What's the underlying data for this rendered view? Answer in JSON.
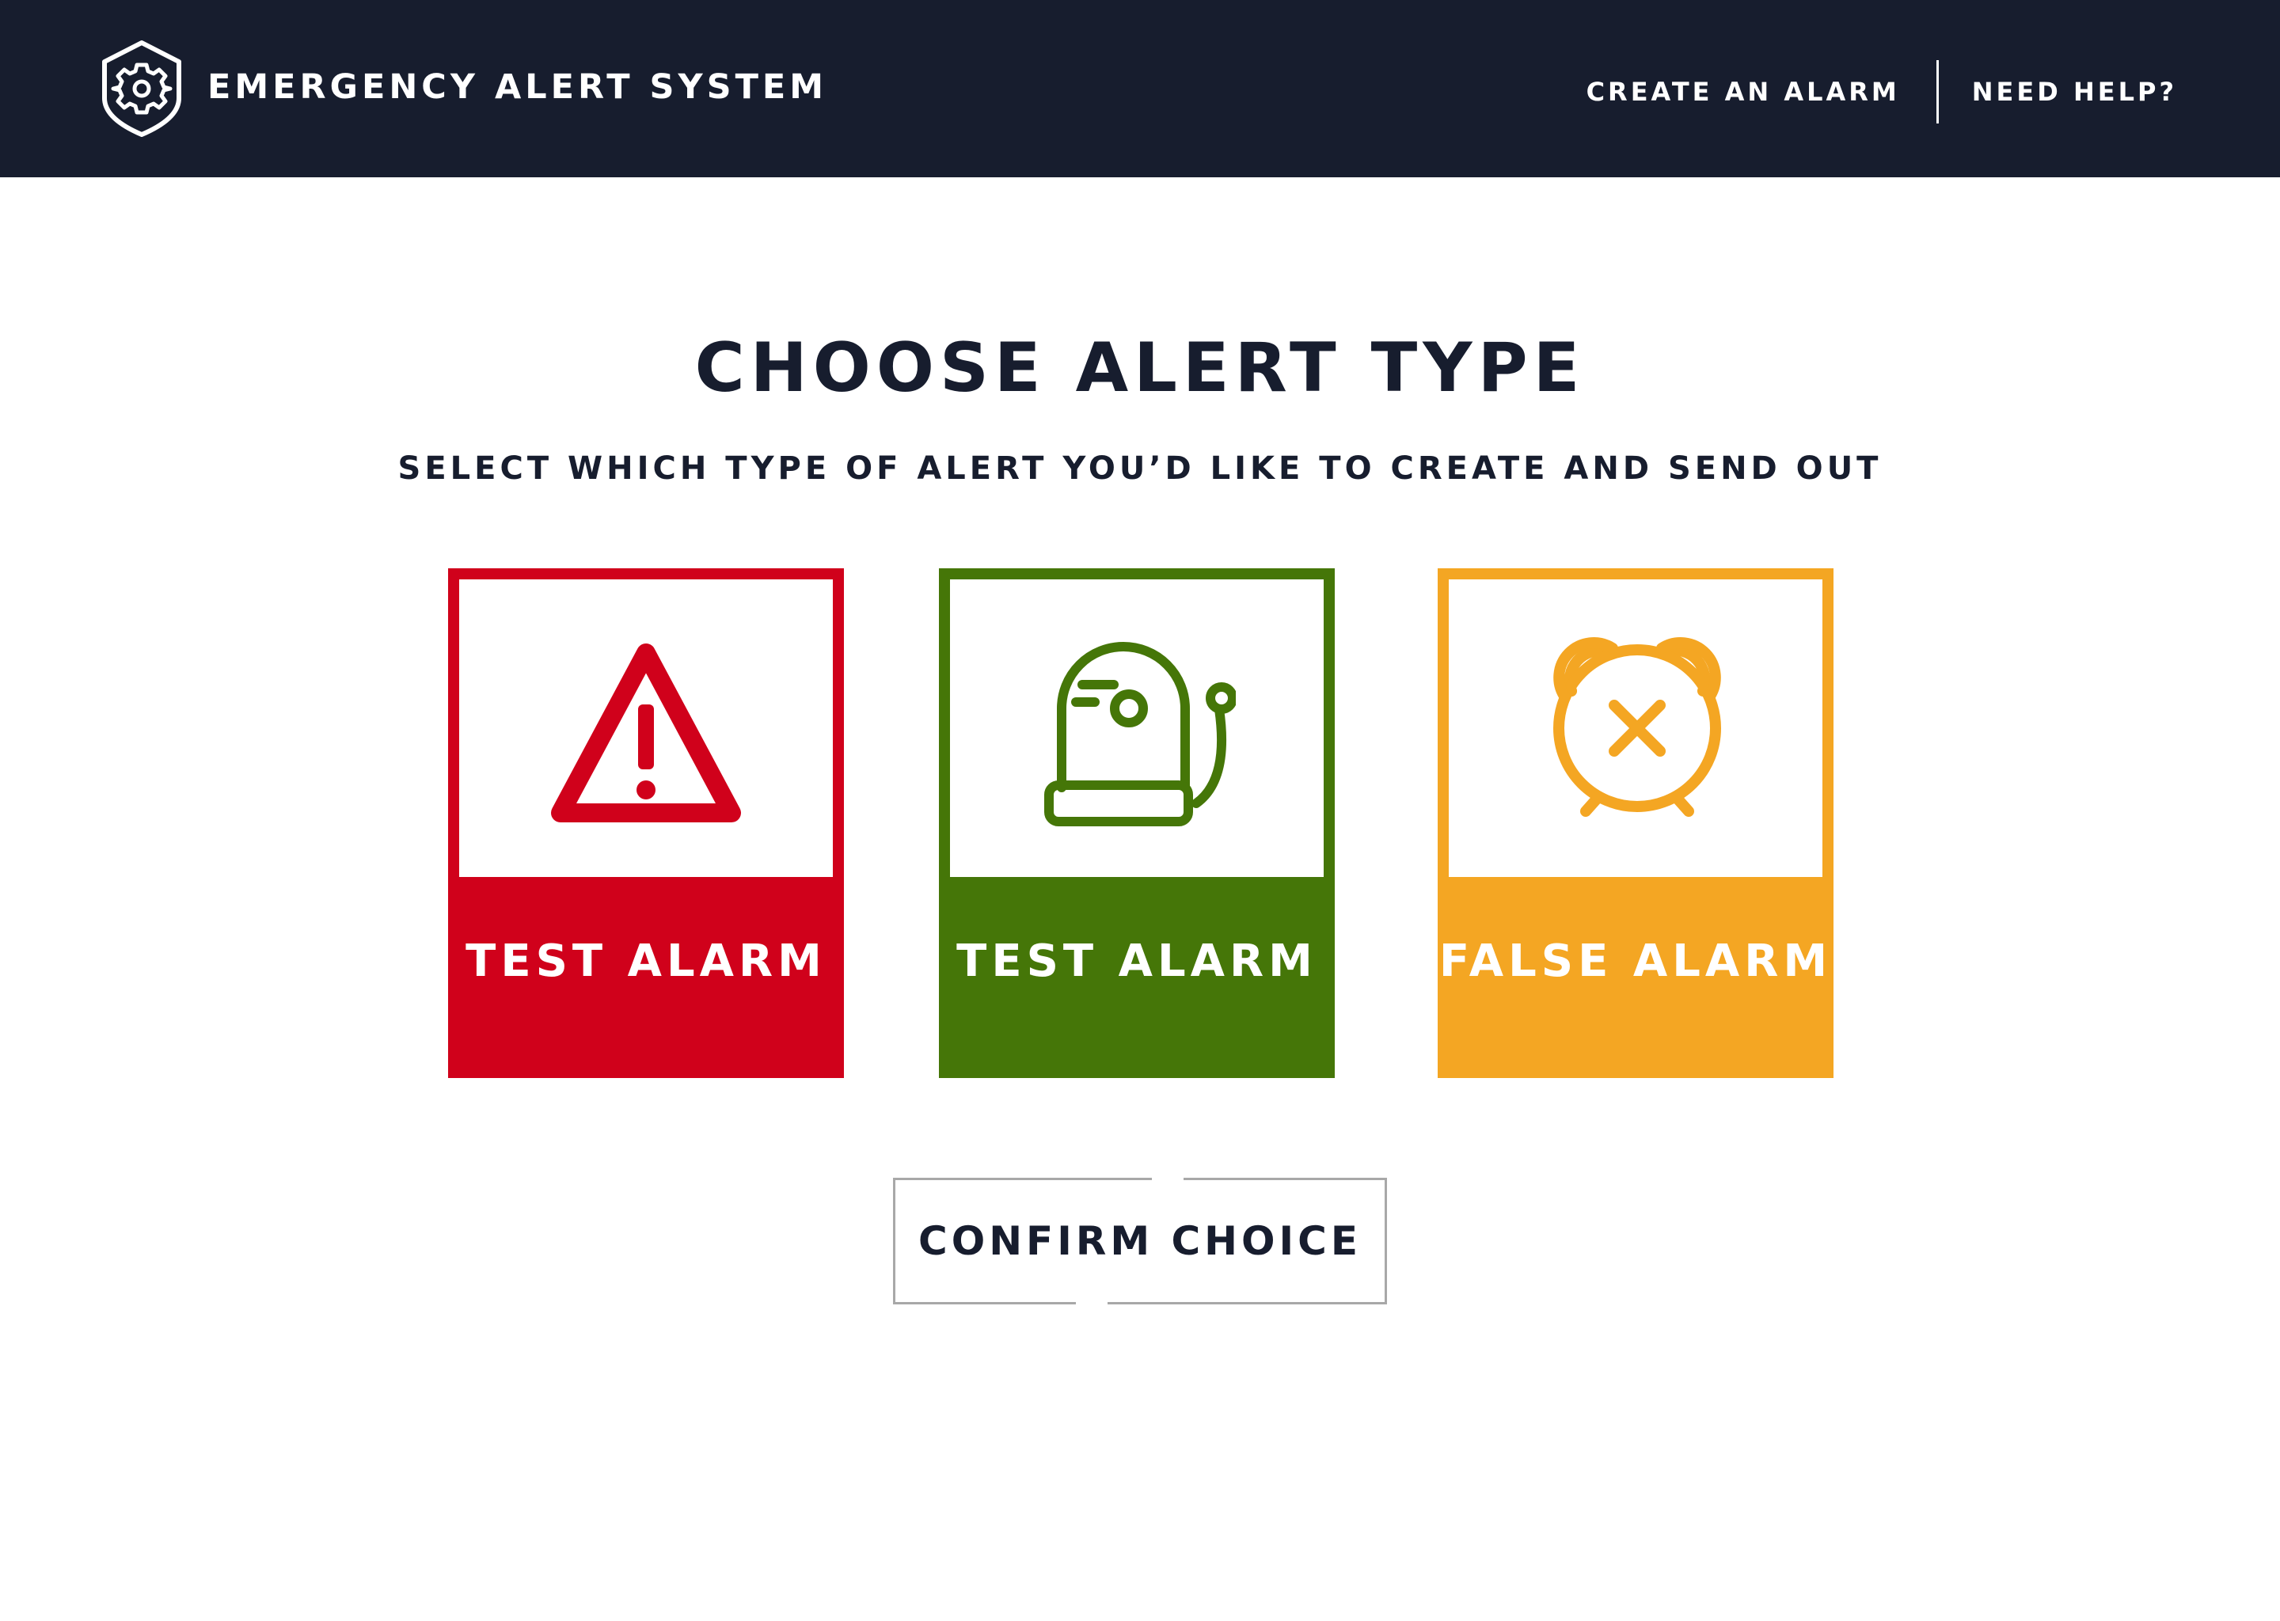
{
  "header": {
    "brand": "EMERGENCY ALERT SYSTEM",
    "logo_icon": "shield-gear-icon",
    "nav": {
      "create": "CREATE AN ALARM",
      "help": "NEED HELP?"
    }
  },
  "main": {
    "title": "CHOOSE ALERT TYPE",
    "subtitle": "SELECT WHICH TYPE OF ALERT YOU’D LIKE TO CREATE AND SEND OUT",
    "cards": [
      {
        "label": "TEST ALARM",
        "icon": "warning-triangle-icon",
        "color": "#d0011b"
      },
      {
        "label": "TEST ALARM",
        "icon": "alarm-bell-icon",
        "color": "#457608"
      },
      {
        "label": "FALSE ALARM",
        "icon": "alarm-clock-x-icon",
        "color": "#f4a623"
      }
    ],
    "confirm_label": "CONFIRM CHOICE"
  },
  "colors": {
    "header_bg": "#171d2e",
    "text_dark": "#171d2e",
    "button_border": "#a8a8a8"
  }
}
